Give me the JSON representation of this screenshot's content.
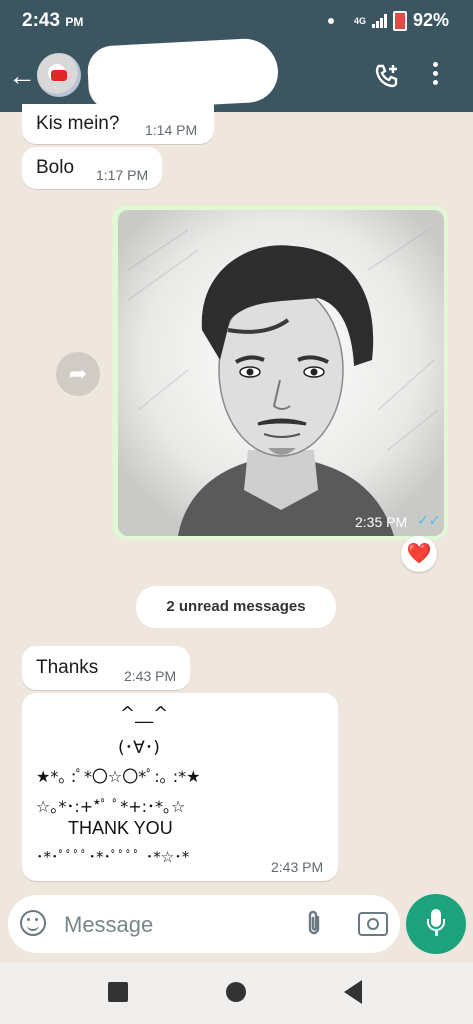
{
  "status_bar": {
    "time": "2:43",
    "ampm": "PM",
    "network": "4G",
    "battery": "92%"
  },
  "header": {
    "back_icon": "arrow-left-icon",
    "call_icon": "add-call-icon",
    "menu_icon": "more-vertical-icon"
  },
  "messages": {
    "msg1": {
      "text": "Kis mein?",
      "time": "1:14 PM"
    },
    "msg2": {
      "text": "Bolo",
      "time": "1:17 PM"
    },
    "image_msg": {
      "time": "2:35 PM",
      "reaction": "❤️"
    },
    "unread_divider": "2 unread messages",
    "msg3": {
      "text": "Thanks",
      "time": "2:43 PM"
    },
    "art_msg": {
      "lines": [
        "^__^",
        "(･∀･)",
        "★*｡ :ﾟ*〇☆〇*ﾟ:｡ :*★",
        "☆｡*･:+*ﾟ ﾟ*+:･*｡☆",
        "THANK YOU",
        "･*･ﾟﾟﾟﾟ･*･ﾟﾟﾟﾟ ･*☆･*"
      ],
      "time": "2:43 PM"
    }
  },
  "composer": {
    "placeholder": "Message"
  },
  "colors": {
    "header": "#3b5561",
    "accent": "#1ca37e",
    "outgoing": "#e1f8d5",
    "tick": "#53bdeb"
  }
}
